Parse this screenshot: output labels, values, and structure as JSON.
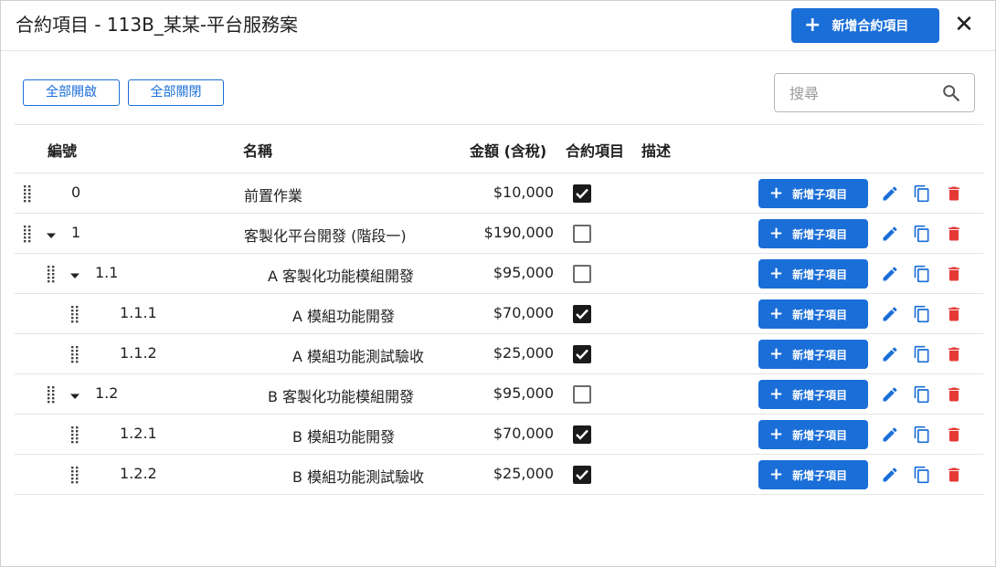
{
  "dialog": {
    "title": "合約項目 - 113B_某某-平台服務案",
    "add_button_label": "新增合約項目",
    "close_label": "✕"
  },
  "toolbar": {
    "expand_all_label": "全部開啟",
    "collapse_all_label": "全部關閉",
    "search": {
      "placeholder": "搜尋",
      "value": ""
    }
  },
  "table": {
    "columns": {
      "number": "編號",
      "name": "名稱",
      "amount": "金額 (含稅)",
      "contract_item": "合約項目",
      "description": "描述"
    },
    "add_child_label": "新增子項目",
    "rows": [
      {
        "number": "0",
        "name": "前置作業",
        "amount": "$10,000",
        "checked": true,
        "level": 0,
        "expandable": false
      },
      {
        "number": "1",
        "name": "客製化平台開發 (階段一)",
        "amount": "$190,000",
        "checked": false,
        "level": 0,
        "expandable": true
      },
      {
        "number": "1.1",
        "name": "A 客製化功能模組開發",
        "amount": "$95,000",
        "checked": false,
        "level": 1,
        "expandable": true
      },
      {
        "number": "1.1.1",
        "name": "A 模組功能開發",
        "amount": "$70,000",
        "checked": true,
        "level": 2,
        "expandable": false
      },
      {
        "number": "1.1.2",
        "name": "A 模組功能測試驗收",
        "amount": "$25,000",
        "checked": true,
        "level": 2,
        "expandable": false
      },
      {
        "number": "1.2",
        "name": "B 客製化功能模組開發",
        "amount": "$95,000",
        "checked": false,
        "level": 1,
        "expandable": true
      },
      {
        "number": "1.2.1",
        "name": "B 模組功能開發",
        "amount": "$70,000",
        "checked": true,
        "level": 2,
        "expandable": false
      },
      {
        "number": "1.2.2",
        "name": "B 模組功能測試驗收",
        "amount": "$25,000",
        "checked": true,
        "level": 2,
        "expandable": false
      }
    ]
  },
  "colors": {
    "primary": "#1a6ed8",
    "delete": "#e53935",
    "border": "#e4e4e4"
  },
  "icons": {
    "drag": "drag-handle-icon",
    "caret": "caret-down-icon",
    "edit": "pencil-icon",
    "copy": "copy-icon",
    "delete": "trash-icon",
    "search": "search-icon",
    "close": "close-icon",
    "add": "plus-icon"
  }
}
